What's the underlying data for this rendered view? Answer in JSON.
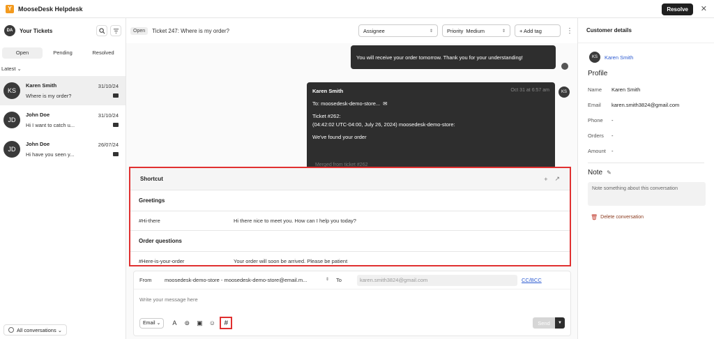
{
  "app": {
    "title": "MooseDesk Helpdesk",
    "logo_letter": "Y",
    "resolve_label": "Resolve",
    "close_glyph": "✕"
  },
  "sidebar": {
    "user_initials": "DA",
    "title": "Your Tickets",
    "tabs": [
      {
        "label": "Open"
      },
      {
        "label": "Pending"
      },
      {
        "label": "Resolved"
      }
    ],
    "sort_label": "Latest",
    "conversations": [
      {
        "initials": "KS",
        "name": "Karen Smith",
        "date": "31/10/24",
        "preview": "Where is my order?"
      },
      {
        "initials": "JD",
        "name": "John Doe",
        "date": "31/10/24",
        "preview": "Hi I want to catch u..."
      },
      {
        "initials": "JD",
        "name": "John Doe",
        "date": "26/07/24",
        "preview": "Hi have you seen y..."
      }
    ],
    "footer_label": "All conversations"
  },
  "ticket": {
    "status": "Open",
    "title": "Ticket 247: Where is my order?",
    "assignee_placeholder": "Assignee",
    "priority_label": "Priority",
    "priority_value": "Medium",
    "add_tag_label": "+ Add tag"
  },
  "messages": {
    "agent_reply": "You will receive your order tomorrow. Thank you for your understanding!",
    "customer": {
      "initials": "KS",
      "name": "Karen Smith",
      "time": "Oct 31 at 6:57 am",
      "to_line": "To: moosedesk-demo-store...",
      "ticket_line": "Ticket #262:",
      "meta_line": "(04:42:02 UTC-04:00, July 26, 2024) moosedesk-demo-store:",
      "body": "We've found your order",
      "merged_note": "Merged from ticket #262"
    }
  },
  "shortcut": {
    "title": "Shortcut",
    "add_glyph": "+",
    "open_glyph": "↗",
    "groups": [
      {
        "name": "Greetings",
        "items": [
          {
            "key": "#Hi-there",
            "text": "Hi there nice to meet you. How can I help you today?"
          }
        ]
      },
      {
        "name": "Order questions",
        "items": [
          {
            "key": "#Here-is-your-order",
            "text": "Your order will soon be arrived. Please be patient"
          }
        ]
      }
    ]
  },
  "composer": {
    "from_label": "From",
    "from_value": "moosedesk-demo-store - moosedesk-demo-store@email.m...",
    "to_label": "To",
    "to_value": "karen.smith3824@gmail.com",
    "ccbcc_label": "CC/BCC",
    "message_placeholder": "Write your message here",
    "channel_label": "Email",
    "send_label": "Send",
    "hashtag_glyph": "#"
  },
  "customer_panel": {
    "header": "Customer details",
    "initials": "KS",
    "contact_name": "Karen Smith",
    "profile_title": "Profile",
    "fields": [
      {
        "label": "Name",
        "value": "Karen Smith"
      },
      {
        "label": "Email",
        "value": "karen.smith3824@gmail.com"
      },
      {
        "label": "Phone",
        "value": "-"
      },
      {
        "label": "Orders",
        "value": "-"
      },
      {
        "label": "Amount",
        "value": "-"
      }
    ],
    "note_title": "Note",
    "note_placeholder": "Note something about this conversation",
    "delete_label": "Delete conversation"
  }
}
